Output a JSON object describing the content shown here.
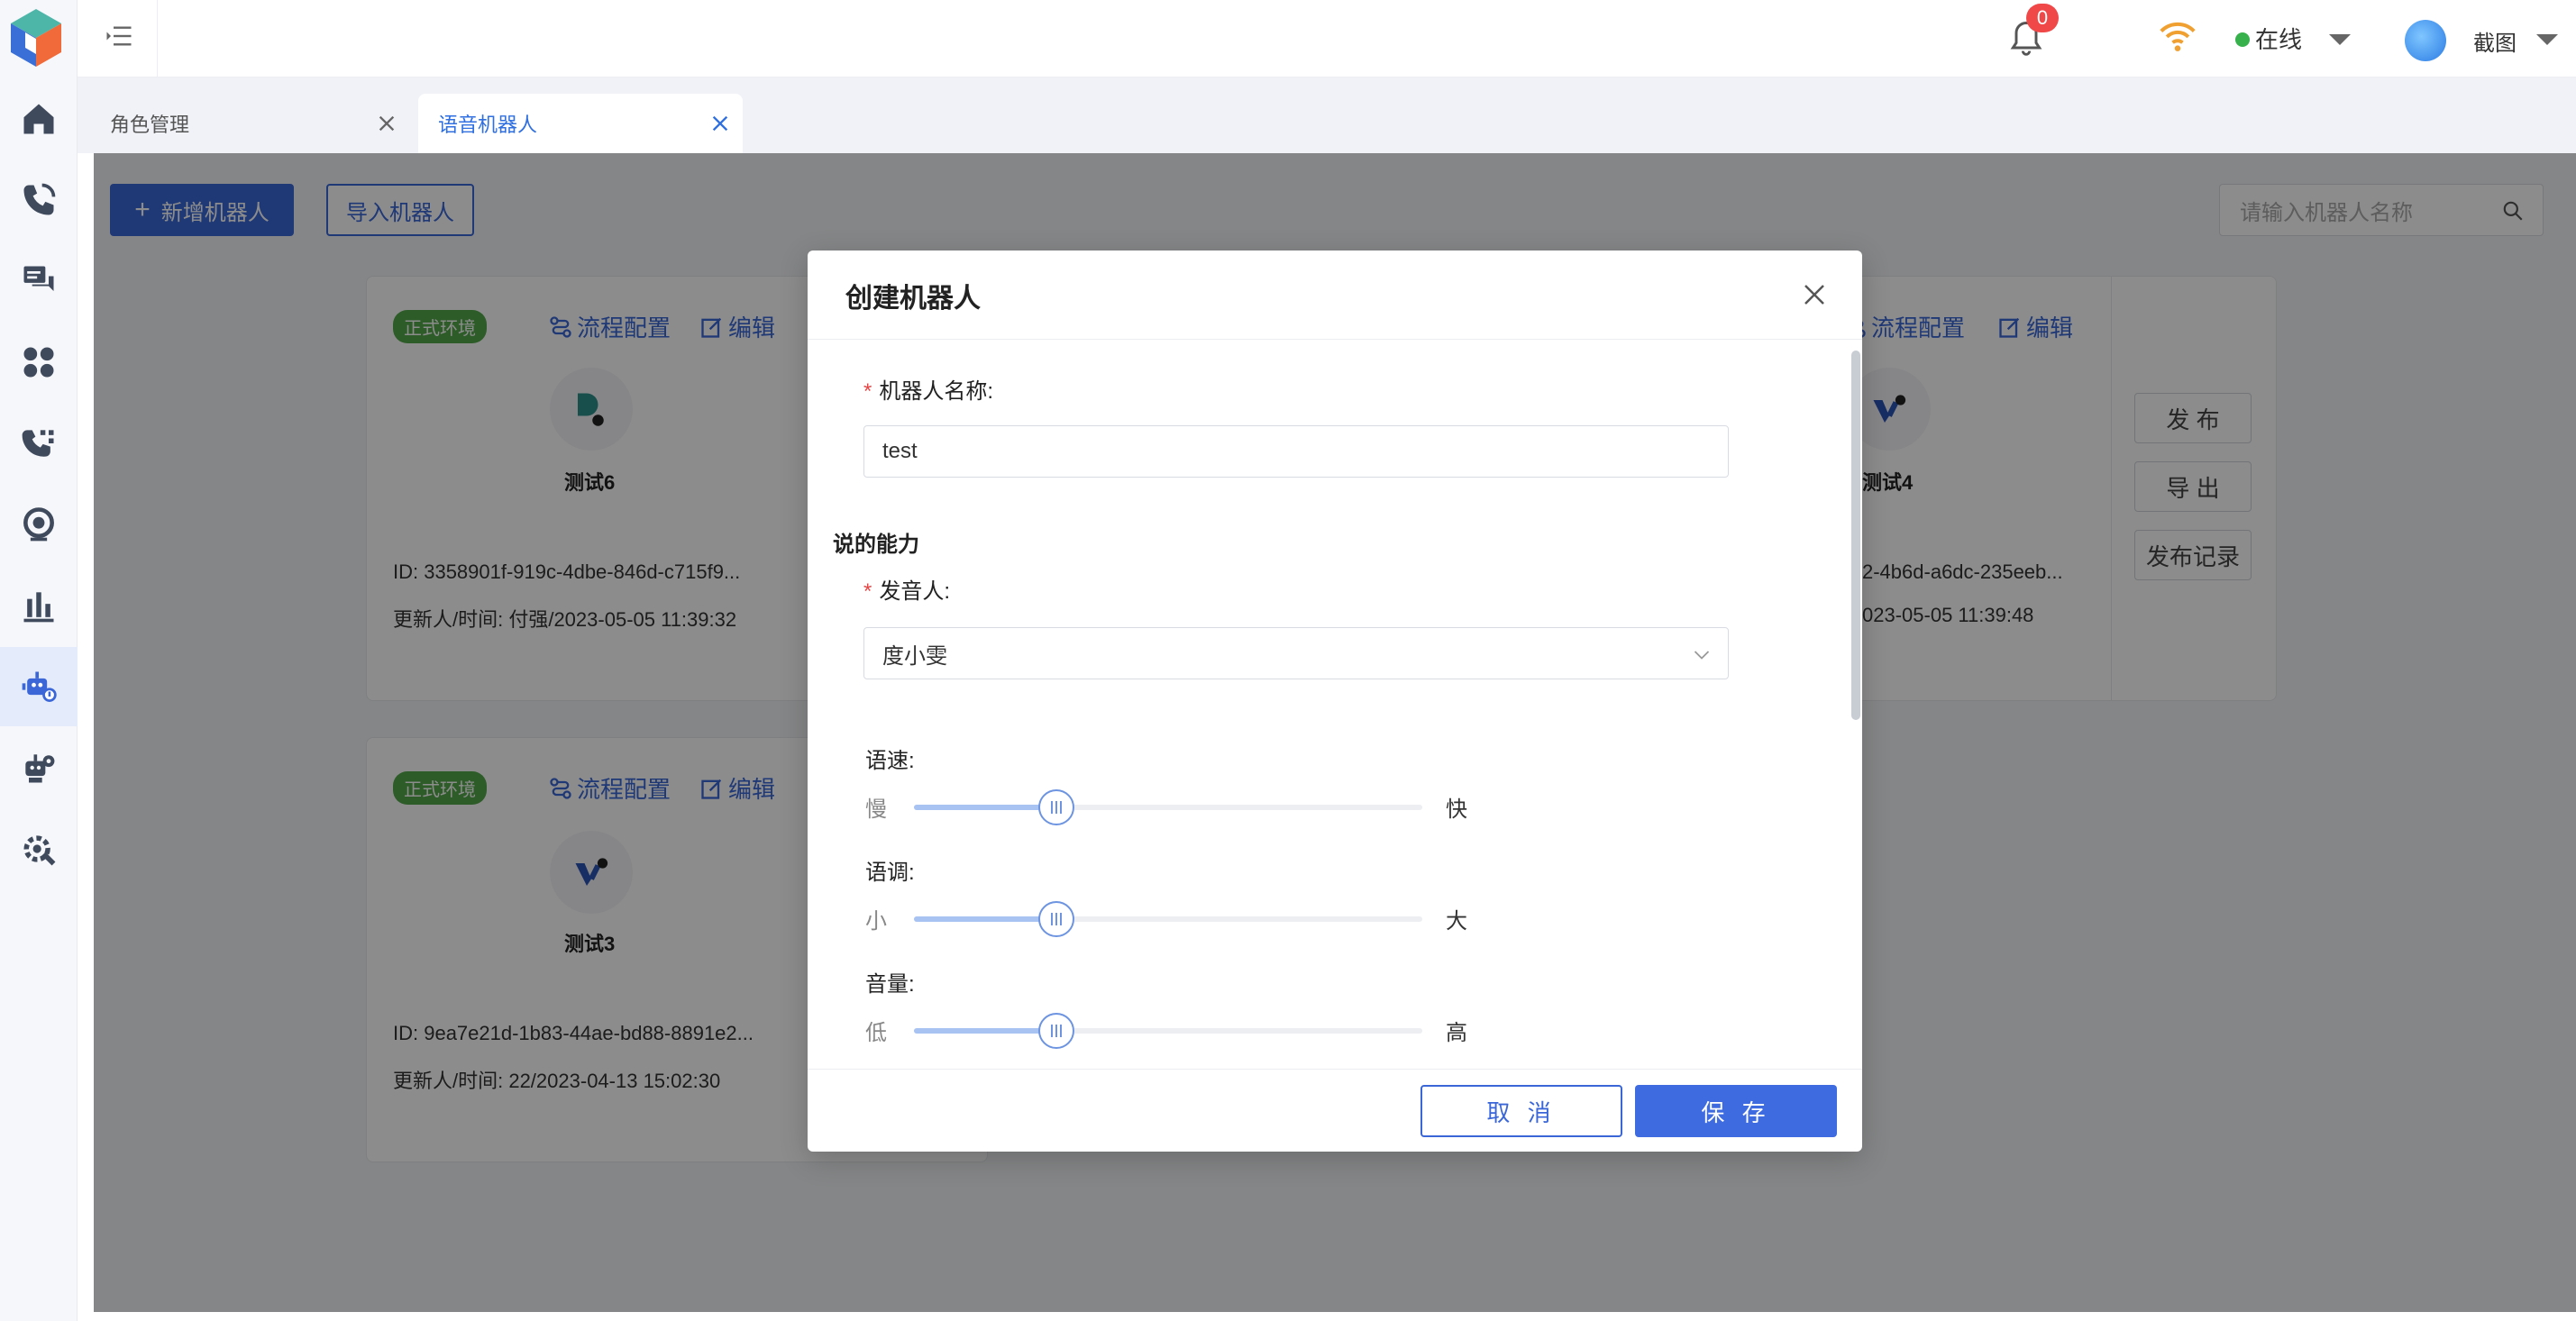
{
  "header": {
    "notification_count": "0",
    "status": "在线",
    "user_name": "截图"
  },
  "tabs": [
    {
      "label": "角色管理",
      "active": false
    },
    {
      "label": "语音机器人",
      "active": true
    }
  ],
  "toolbar": {
    "add_label": "新增机器人",
    "import_label": "导入机器人",
    "search_placeholder": "请输入机器人名称"
  },
  "cards": [
    {
      "env": "正式环境",
      "flow_label": "流程配置",
      "edit_label": "编辑",
      "name": "测试6",
      "id": "ID: 3358901f-919c-4dbe-846d-c715f9...",
      "updated": "更新人/时间: 付强/2023-05-05 11:39:32"
    },
    {
      "env": "正式环境",
      "flow_label": "流程配置",
      "edit_label": "编辑",
      "name": "测试3",
      "id": "ID: 9ea7e21d-1b83-44ae-bd88-8891e2...",
      "updated": "更新人/时间: 22/2023-04-13 15:02:30"
    },
    {
      "flow_label": "流程配置",
      "edit_label": "编辑",
      "name": "测试4",
      "id": "2-4b6d-a6dc-235eeb...",
      "updated": "023-05-05 11:39:48"
    }
  ],
  "side_actions": {
    "publish": "发 布",
    "export": "导 出",
    "publish_history": "发布记录"
  },
  "modal": {
    "title": "创建机器人",
    "name_label": "机器人名称:",
    "name_value": "test",
    "section_speak": "说的能力",
    "speaker_label": "发音人:",
    "speaker_value": "度小雯",
    "sliders": [
      {
        "label": "语速:",
        "min_label": "慢",
        "max_label": "快",
        "value_percent": 28
      },
      {
        "label": "语调:",
        "min_label": "小",
        "max_label": "大",
        "value_percent": 28
      },
      {
        "label": "音量:",
        "min_label": "低",
        "max_label": "高",
        "value_percent": 28
      }
    ],
    "cancel_label": "取 消",
    "save_label": "保 存"
  },
  "colors": {
    "primary": "#3a66d8",
    "env_badge": "#52a84a",
    "online": "#36b14b",
    "badge_red": "#f04848"
  }
}
